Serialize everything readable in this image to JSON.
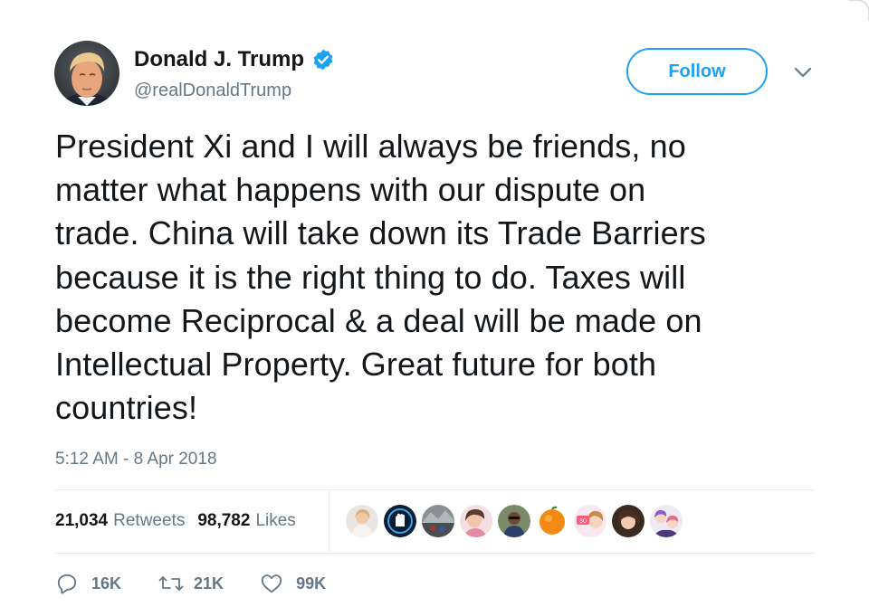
{
  "author": {
    "display_name": "Donald J. Trump",
    "handle": "@realDonaldTrump",
    "verified": true
  },
  "follow_button": {
    "label": "Follow"
  },
  "tweet": {
    "text": "President Xi and I will always be friends, no\nmatter what happens with our dispute on\ntrade. China will take down its Trade Barriers\nbecause it is the right thing to do. Taxes will\nbecome Reciprocal & a deal will be made on\nIntellectual Property. Great future for both\ncountries!",
    "timestamp": "5:12 AM - 8 Apr 2018"
  },
  "stats": {
    "retweets_count": "21,034",
    "retweets_label": "Retweets",
    "likes_count": "98,782",
    "likes_label": "Likes"
  },
  "likers": [
    {
      "icon": "avatar-woman-light"
    },
    {
      "icon": "avatar-fist-blue"
    },
    {
      "icon": "avatar-mountain-crowd"
    },
    {
      "icon": "avatar-woman-pink"
    },
    {
      "icon": "avatar-man-sunglasses"
    },
    {
      "icon": "avatar-orange-fruit"
    },
    {
      "icon": "avatar-anime-30"
    },
    {
      "icon": "avatar-woman-dark-hair"
    },
    {
      "icon": "avatar-anime-characters"
    }
  ],
  "actions": {
    "reply_count": "16K",
    "retweet_count": "21K",
    "like_count": "99K"
  },
  "colors": {
    "accent": "#1da1f2",
    "text_primary": "#14171a",
    "text_secondary": "#657786",
    "divider": "#e6ecf0"
  }
}
